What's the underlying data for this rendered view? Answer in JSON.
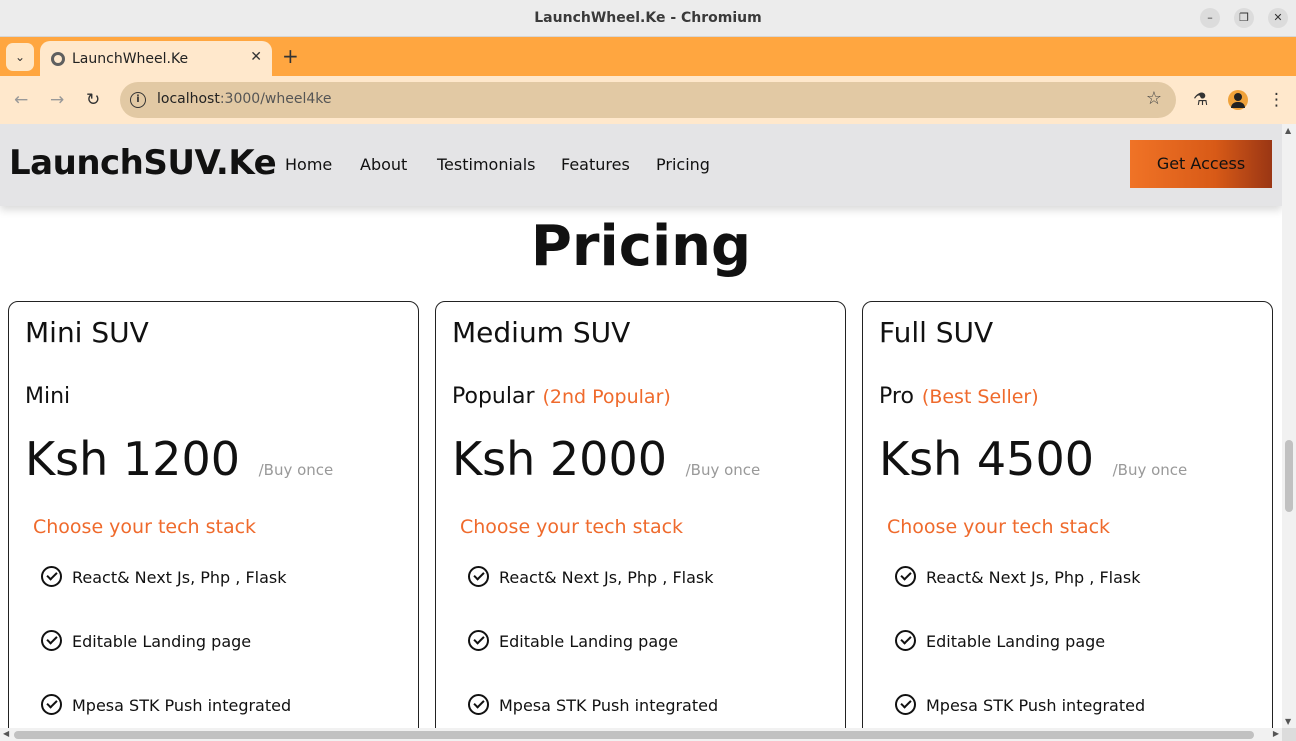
{
  "window": {
    "title": "LaunchWheel.Ke - Chromium",
    "minimize_glyph": "–",
    "maximize_glyph": "❐",
    "close_glyph": "✕"
  },
  "browser": {
    "tab_list_glyph": "⌄",
    "tab_title": "LaunchWheel.Ke",
    "tab_close_glyph": "✕",
    "new_tab_glyph": "+",
    "back_glyph": "←",
    "forward_glyph": "→",
    "reload_glyph": "↻",
    "info_glyph": "i",
    "url_host": "localhost",
    "url_path": ":3000/wheel4ke",
    "star_glyph": "☆",
    "labs_glyph": "⚗",
    "menu_glyph": "⋮"
  },
  "site": {
    "logo": "LaunchSUV.Ke",
    "nav": [
      "Home",
      "About",
      "Testimonials",
      "Features",
      "Pricing"
    ],
    "cta": "Get Access"
  },
  "pricing": {
    "title": "Pricing",
    "plans": [
      {
        "name": "Mini SUV",
        "tier": "Mini",
        "badge": "",
        "price": "Ksh 1200",
        "period": "/Buy once",
        "stack_label": "Choose your tech stack",
        "features": [
          "React& Next Js, Php , Flask",
          "Editable Landing page",
          "Mpesa STK Push integrated"
        ]
      },
      {
        "name": "Medium SUV",
        "tier": "Popular",
        "badge": "(2nd Popular)",
        "price": "Ksh 2000",
        "period": "/Buy once",
        "stack_label": "Choose your tech stack",
        "features": [
          "React& Next Js, Php , Flask",
          "Editable Landing page",
          "Mpesa STK Push integrated"
        ]
      },
      {
        "name": "Full SUV",
        "tier": "Pro",
        "badge": "(Best Seller)",
        "price": "Ksh 4500",
        "period": "/Buy once",
        "stack_label": "Choose your tech stack",
        "features": [
          "React& Next Js, Php , Flask",
          "Editable Landing page",
          "Mpesa STK Push integrated"
        ]
      }
    ]
  },
  "scrollbars": {
    "up_glyph": "▲",
    "down_glyph": "▼",
    "left_glyph": "◀",
    "right_glyph": "▶"
  },
  "colors": {
    "tab_strip": "#ffa640",
    "toolbar": "#ffe8cc",
    "accent": "#ef6a2c",
    "cta_start": "#f07326",
    "cta_end": "#9a3614"
  }
}
